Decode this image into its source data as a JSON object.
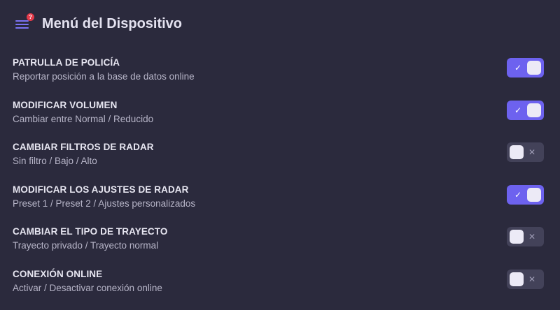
{
  "header": {
    "title": "Menú del Dispositivo",
    "notification_count": "?"
  },
  "settings": [
    {
      "title": "PATRULLA DE POLICÍA",
      "description": "Reportar posición a la base de datos online",
      "enabled": true
    },
    {
      "title": "MODIFICAR VOLUMEN",
      "description": "Cambiar entre Normal / Reducido",
      "enabled": true
    },
    {
      "title": "CAMBIAR FILTROS DE RADAR",
      "description": "Sin filtro / Bajo / Alto",
      "enabled": false
    },
    {
      "title": "MODIFICAR LOS AJUSTES DE RADAR",
      "description": "Preset 1 / Preset 2 / Ajustes personalizados",
      "enabled": true
    },
    {
      "title": "CAMBIAR EL TIPO DE TRAYECTO",
      "description": "Trayecto privado / Trayecto normal",
      "enabled": false
    },
    {
      "title": "CONEXIÓN ONLINE",
      "description": "Activar / Desactivar conexión online",
      "enabled": false
    }
  ],
  "icons": {
    "menu": "hamburger-menu-icon",
    "toggle_on": "check-icon",
    "toggle_off": "x-icon"
  },
  "colors": {
    "background": "#2b2a3d",
    "accent": "#6d62ef",
    "toggle_off": "#434259",
    "badge": "#e43a4a"
  }
}
